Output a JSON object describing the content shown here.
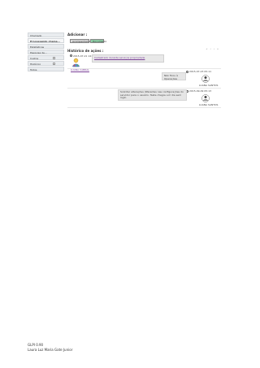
{
  "sidebar": {
    "items": [
      {
        "label": "Chamado"
      },
      {
        "label": "Processando chama..."
      },
      {
        "label": "Estatísticas"
      },
      {
        "label": "Pesquisa de..."
      },
      {
        "label": "Custos"
      },
      {
        "label": "Histórico"
      },
      {
        "label": "Todos"
      }
    ]
  },
  "main": {
    "add_title": "Adicionar :",
    "buttons": {
      "followup": "Acompanhamento",
      "document": "Documento"
    },
    "history_title": "Histórico de ações :",
    "pager": "« ‹ › »",
    "entries": [
      {
        "date": "2015-07-21 14:36",
        "link": "Cadastrado durante serviços propriedade",
        "user": "LUANA CABRAL"
      },
      {
        "date": "2015-07-23 05:11",
        "message": "Não ficou à Operações",
        "user": "LUANA SANTOS"
      },
      {
        "date": "2015-09-09 05:13",
        "message": "Solicitar alterações diferentes nas configurações do servidor para o usuário. Teste chegou um dia sem login.",
        "user": "LUANA SANTOS"
      }
    ]
  },
  "footer": {
    "version": "GLPI 0.90",
    "author": "Laura Luz Maria Gate Junior"
  }
}
